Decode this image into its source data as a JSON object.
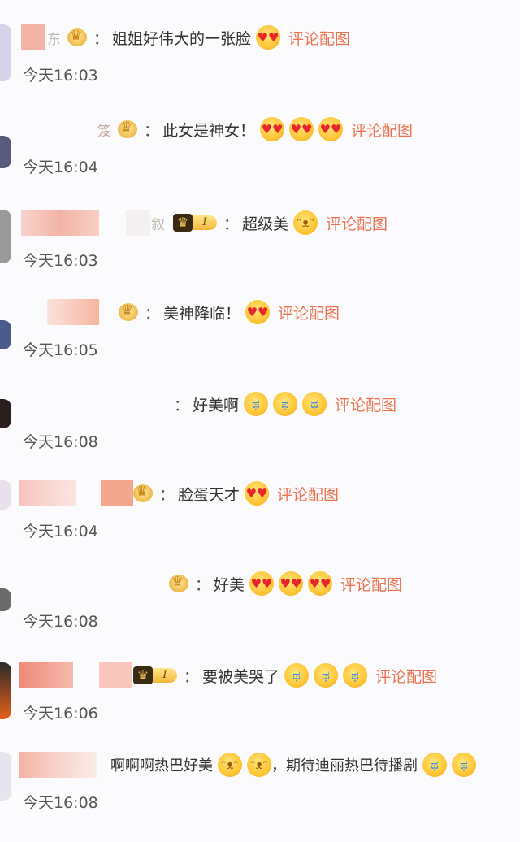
{
  "comments": [
    {
      "text": "姐姐好伟大的一张脸",
      "emojis": [
        "heart-eyes"
      ],
      "link": "评论配图",
      "time": "今天16:03",
      "name_partial": "东"
    },
    {
      "text": "此女是神女！",
      "emojis": [
        "heart-eyes",
        "heart-eyes",
        "heart-eyes"
      ],
      "link": "评论配图",
      "time": "今天16:04",
      "name_partial": "笈"
    },
    {
      "text": "超级美",
      "emojis": [
        "cute-face"
      ],
      "link": "评论配图",
      "time": "今天16:03",
      "name_partial": "叙",
      "vip_label": "I"
    },
    {
      "text": "美神降临！",
      "emojis": [
        "heart-eyes"
      ],
      "link": "评论配图",
      "time": "今天16:05"
    },
    {
      "text": "好美啊",
      "emojis": [
        "crying-face",
        "crying-face",
        "crying-face"
      ],
      "link": "评论配图",
      "time": "今天16:08"
    },
    {
      "text": "脸蛋天才",
      "emojis": [
        "heart-eyes"
      ],
      "link": "评论配图",
      "time": "今天16:04"
    },
    {
      "text": "好美",
      "emojis": [
        "heart-eyes",
        "heart-eyes",
        "heart-eyes"
      ],
      "link": "评论配图",
      "time": "今天16:08"
    },
    {
      "text": "要被美哭了",
      "emojis": [
        "crying-face",
        "crying-face",
        "crying-face"
      ],
      "link": "评论配图",
      "time": "今天16:06",
      "vip_label": "I"
    },
    {
      "text": "啊啊啊热巴好美",
      "text2": "，期待迪丽热巴待播剧",
      "emojis": [
        "cute-face",
        "cute-face"
      ],
      "emojis2": [
        "crying-face",
        "crying-face"
      ],
      "time": "今天16:08"
    }
  ],
  "colors": {
    "link": "#eb7350",
    "background": "#fbfbfd",
    "time": "#555555"
  }
}
